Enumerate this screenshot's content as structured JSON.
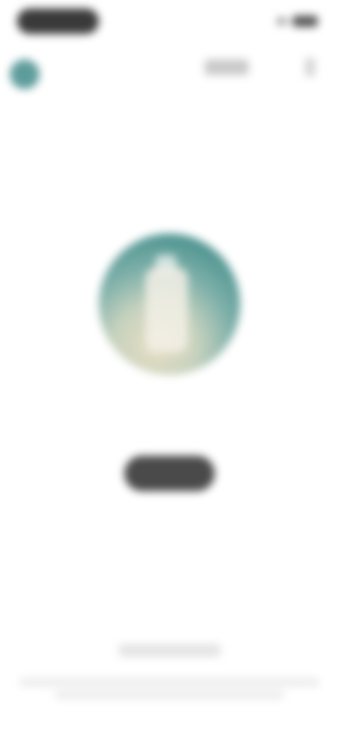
{
  "status_bar": {
    "left_pill_label": "",
    "signal_icon": "signal-icon",
    "battery_icon": "battery-icon"
  },
  "header": {
    "avatar_icon": "profile-avatar",
    "action_label": "",
    "menu_icon": "more-icon",
    "accent_color": "#5e9c9c"
  },
  "main": {
    "illustration_icon": "person-illustration",
    "subtitle": "",
    "cta_label": ""
  },
  "footer": {
    "title": "",
    "description": ""
  }
}
